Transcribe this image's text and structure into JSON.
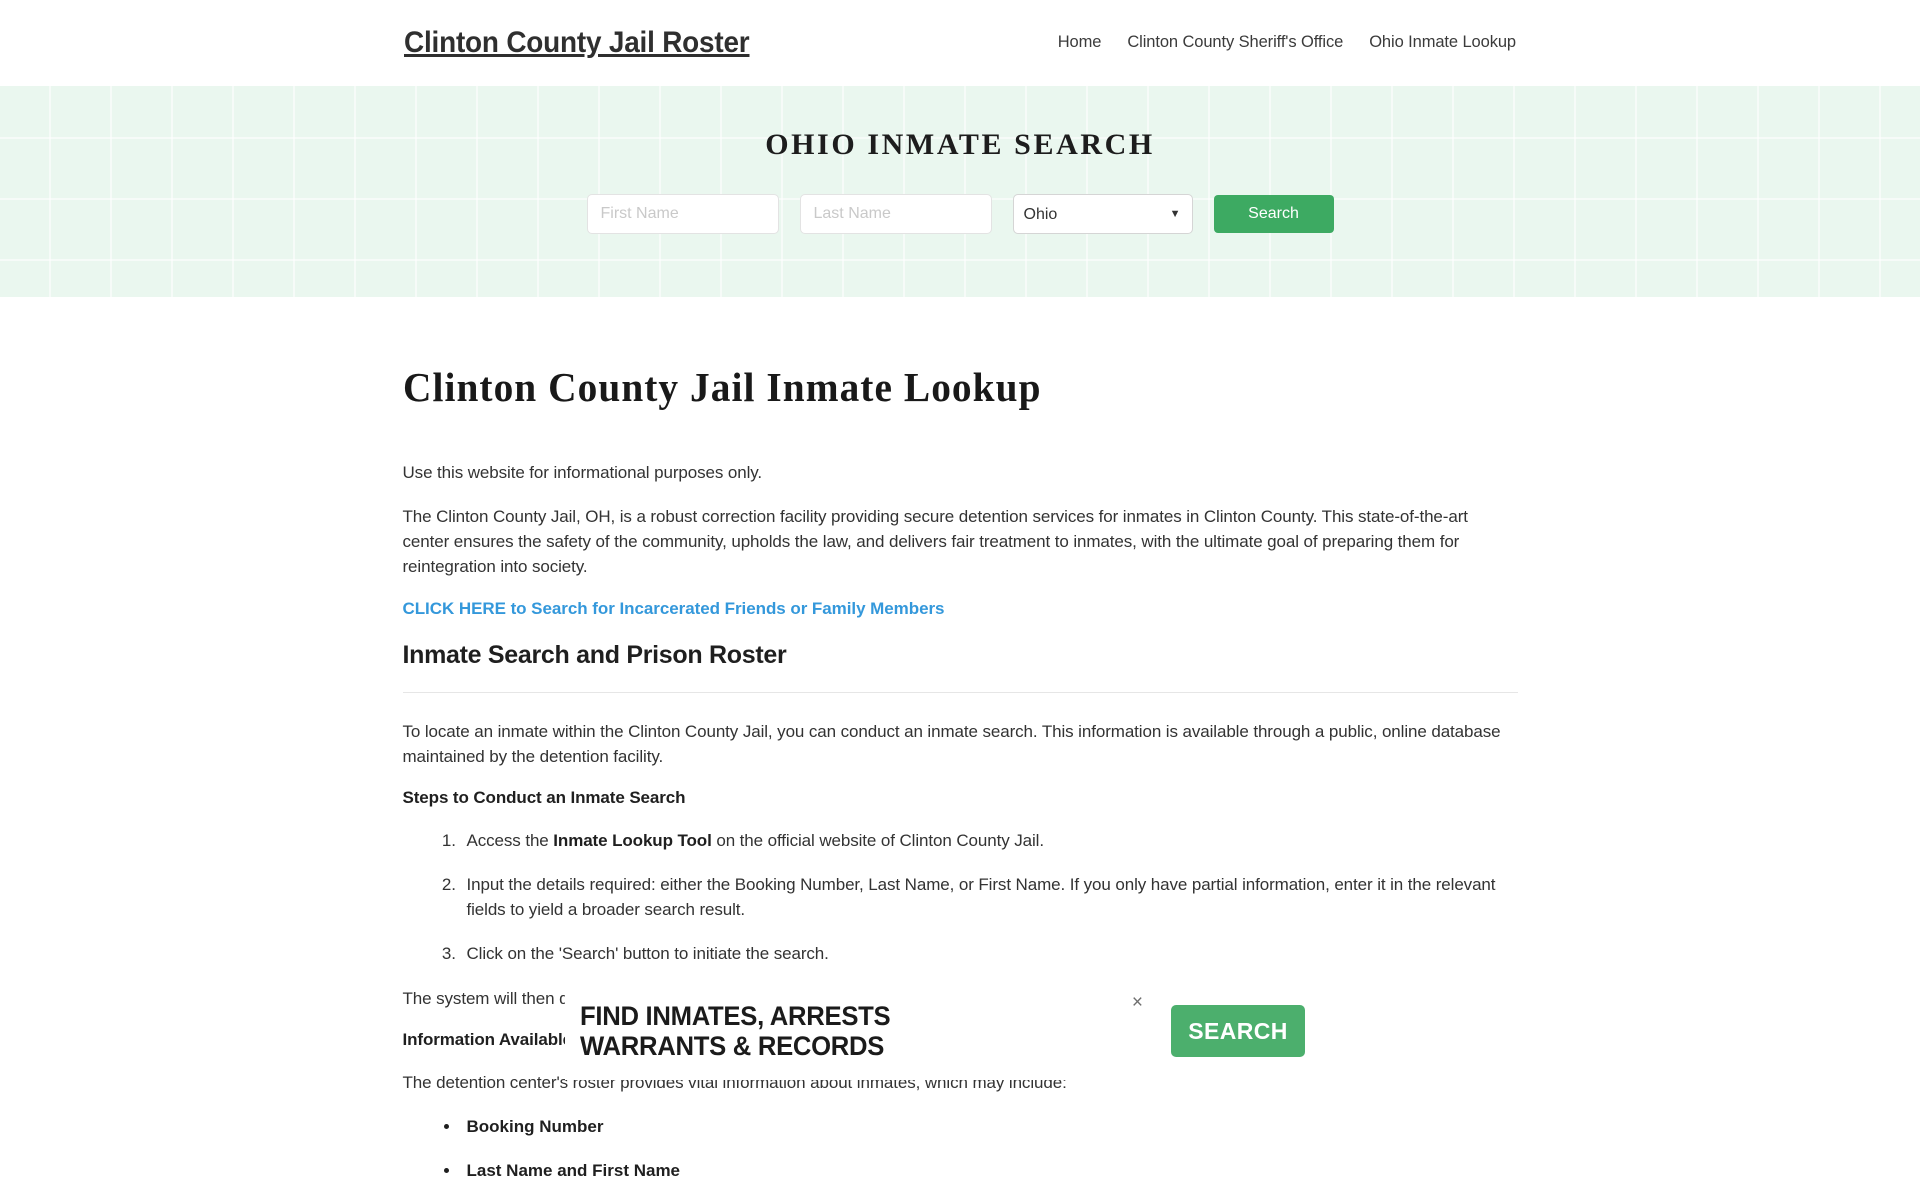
{
  "header": {
    "site_title": "Clinton County Jail Roster",
    "nav": [
      {
        "label": "Home"
      },
      {
        "label": "Clinton County Sheriff's Office"
      },
      {
        "label": "Ohio Inmate Lookup"
      }
    ]
  },
  "hero": {
    "title": "OHIO INMATE SEARCH",
    "first_name_placeholder": "First Name",
    "first_name_value": "",
    "last_name_placeholder": "Last Name",
    "last_name_value": "",
    "state_selected": "Ohio",
    "state_options": [
      "Ohio"
    ],
    "search_label": "Search",
    "accent_color": "#3daa62",
    "background_color": "#eaf7ef"
  },
  "main": {
    "page_title": "Clinton County Jail Inmate Lookup",
    "disclaimer": "Use this website for informational purposes only.",
    "intro": "The Clinton County Jail, OH, is a robust correction facility providing secure detention services for inmates in Clinton County. This state-of-the-art center ensures the safety of the community, upholds the law, and delivers fair treatment to inmates, with the ultimate goal of preparing them for reintegration into society.",
    "cta_link": "CLICK HERE to Search for Incarcerated Friends or Family Members",
    "cta_color": "#3498db",
    "section_heading": "Inmate Search and Prison Roster",
    "section_intro": "To locate an inmate within the Clinton County Jail, you can conduct an inmate search. This information is available through a public, online database maintained by the detention facility.",
    "steps_heading": "Steps to Conduct an Inmate Search",
    "steps": [
      {
        "text_before": "Access the ",
        "bold": "Inmate Lookup Tool",
        "text_after": " on the official website of Clinton County Jail."
      },
      {
        "text_before": "Input the details required: either the Booking Number, Last Name, or First Name. If you only have partial information, enter it in the relevant fields to yield a broader search result.",
        "bold": "",
        "text_after": ""
      },
      {
        "text_before": "Click on the 'Search' button to initiate the search.",
        "bold": "",
        "text_after": ""
      }
    ],
    "steps_outro": "The system will then display a list of inmates that match the search parameters.",
    "info_heading": "Information Available on the Jail Roster",
    "info_intro": "The detention center's roster provides vital information about inmates, which may include:",
    "info_items": [
      {
        "label": "Booking Number"
      },
      {
        "label": "Last Name and First Name"
      }
    ]
  },
  "promo": {
    "line1": "FIND INMATES, ARRESTS",
    "line2": "WARRANTS & RECORDS",
    "search_label": "SEARCH",
    "close_icon": "×",
    "button_color": "#4caf6d"
  }
}
